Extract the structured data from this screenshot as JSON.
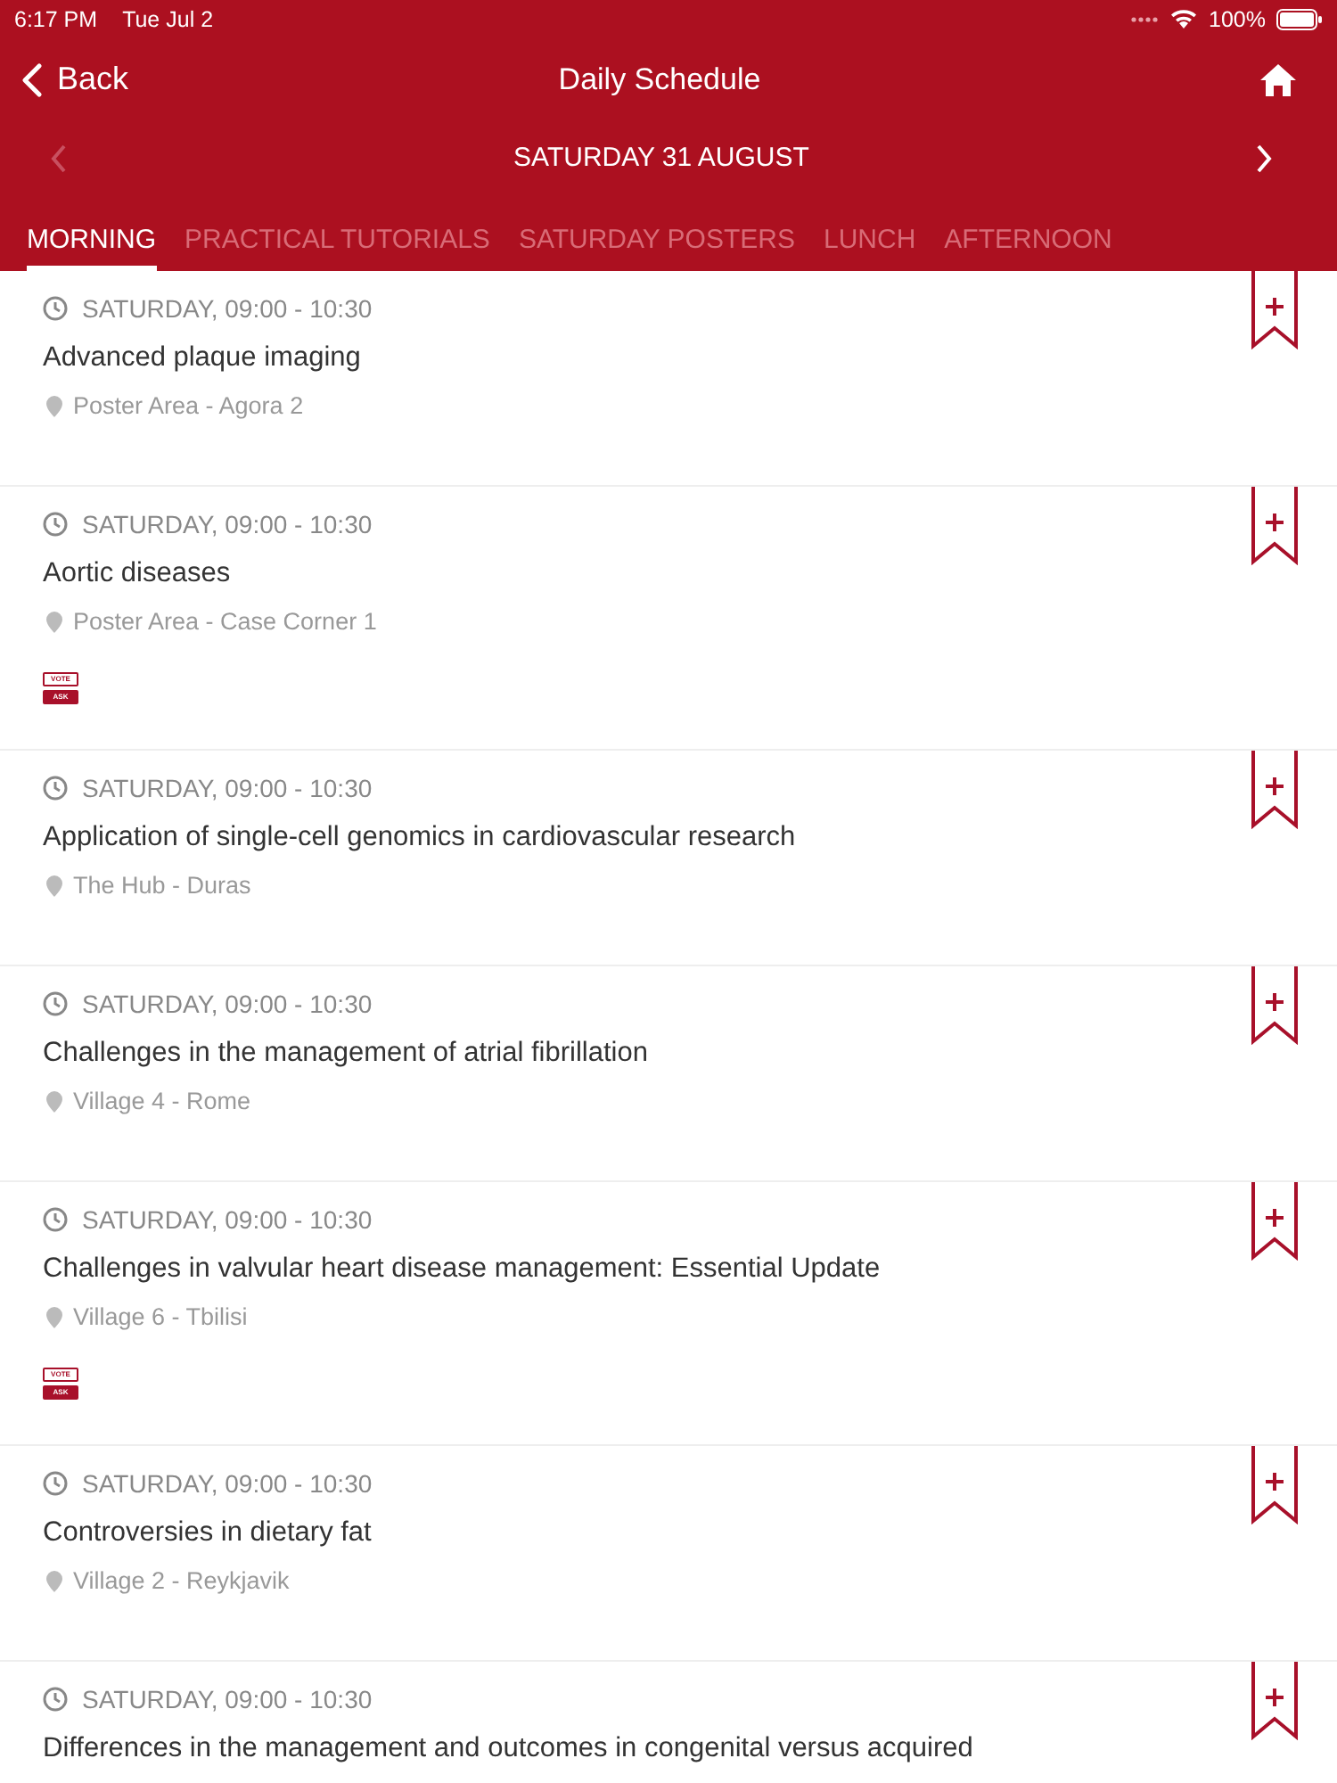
{
  "status_bar": {
    "time": "6:17 PM",
    "date": "Tue Jul 2",
    "battery": "100%"
  },
  "nav": {
    "back": "Back",
    "title": "Daily Schedule"
  },
  "date_bar": {
    "label": "SATURDAY 31 AUGUST",
    "prev_enabled": false,
    "next_enabled": true
  },
  "tabs": [
    {
      "label": "MORNING",
      "selected": true
    },
    {
      "label": "PRACTICAL TUTORIALS",
      "selected": false
    },
    {
      "label": "SATURDAY POSTERS",
      "selected": false
    },
    {
      "label": "LUNCH",
      "selected": false
    },
    {
      "label": "AFTERNOON",
      "selected": false
    }
  ],
  "sessions": [
    {
      "time": "SATURDAY, 09:00 - 10:30",
      "title": "Advanced plaque imaging",
      "location": "Poster Area - Agora 2"
    },
    {
      "time": "SATURDAY, 09:00 - 10:30",
      "title": "Aortic diseases",
      "location": "Poster Area - Case Corner 1",
      "badges": [
        "VOTE",
        "ASK"
      ]
    },
    {
      "time": "SATURDAY, 09:00 - 10:30",
      "title": "Application of single-cell genomics in cardiovascular research",
      "location": "The Hub - Duras"
    },
    {
      "time": "SATURDAY, 09:00 - 10:30",
      "title": "Challenges in the management of atrial fibrillation",
      "location": "Village 4 - Rome"
    },
    {
      "time": "SATURDAY, 09:00 - 10:30",
      "title": "Challenges in valvular heart disease management: Essential Update",
      "location": "Village 6 - Tbilisi",
      "badges": [
        "VOTE",
        "ASK"
      ]
    },
    {
      "time": "SATURDAY, 09:00 - 10:30",
      "title": "Controversies in dietary fat",
      "location": "Village 2 - Reykjavik"
    },
    {
      "time": "SATURDAY, 09:00 - 10:30",
      "title": "Differences in the management and outcomes in congenital versus acquired"
    }
  ]
}
